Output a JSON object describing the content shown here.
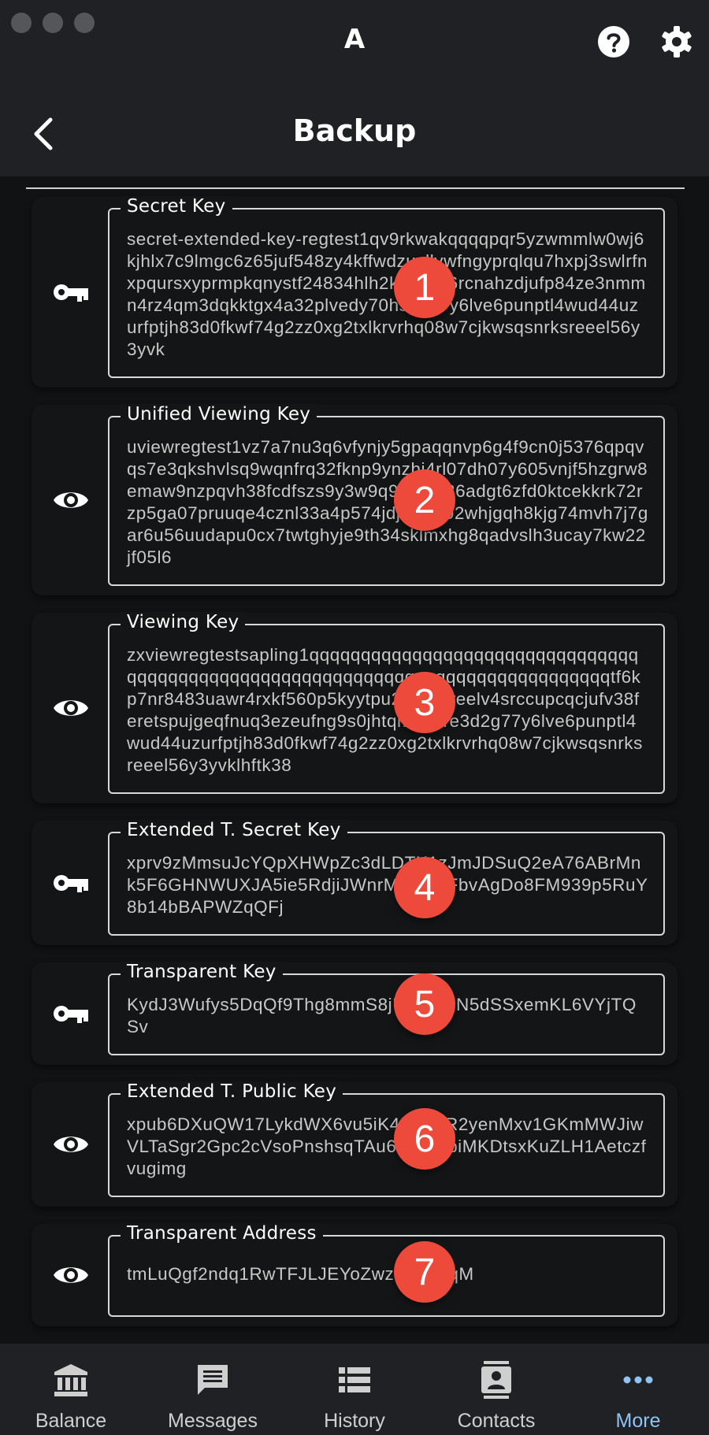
{
  "window": {
    "app_letter": "A"
  },
  "header": {
    "title": "Backup"
  },
  "keys": [
    {
      "badge": "1",
      "icon": "key-icon",
      "label": "Secret Key",
      "value": "secret-extended-key-regtest1qv9rkwakqqqqpqr5yzwmmlw0wj6kjhlx7c9lmgc6z65juf548zy4kffwdzuvllvwfngyprqlqu7hxpj3swlrfnxpqursxyprmpkqnystf24834hlh2kqqy8c6rcnahzdjufp84ze3nmmn4rz4qm3dqkktgx4a32plvedy70hspg77y6lve6punptl4wud44uzurfptjh83d0fkwf74g2zz0xg2txlkrvrhq08w7cjkwsqsnrksreeel56y3yvk"
    },
    {
      "badge": "2",
      "icon": "eye-icon",
      "label": "Unified Viewing Key",
      "value": "uviewregtest1vz7a7nu3q6vfynjy5gpaqqnvp6g4f9cn0j5376qpqvqs7e3qkshvlsq9wqnfrq32fknp9ynzhj4rl07dh07y605vnjf5hzgrw8emaw9nzpqvh38fcdfszs9y3w9q9rplm936adgt6zfd0ktcekkrk72rzp5ga07pruuqe4cznl33a4p574jdjrqahr02whjgqh8kjg74mvh7j7gar6u56uudapu0cx7twtghyje9th34sklmxhg8qadvslh3ucay7kw22jf05l6"
    },
    {
      "badge": "3",
      "icon": "eye-icon",
      "label": "Viewing Key",
      "value": "zxviewregtestsapling1qqqqqqqqqqqqqqqqqqqqqqqqqqqqqqqqqqqqqqqqqqqqqqqqqqqqqqqqqqqqqqqqqqqqqqqqqqqqqqqtf6kp7nr8483uawr4rxkf560p5kyytpu26h6pweelv4srccupcqcjufv38feretspujgeqfnuq3ezeufng9s0jhtqm5u3re3d2g77y6lve6punptl4wud44uzurfptjh83d0fkwf74g2zz0xg2txlkrvrhq08w7cjkwsqsnrksreeel56y3yvklhftk38"
    },
    {
      "badge": "4",
      "icon": "key-icon",
      "label": "Extended T. Secret Key",
      "value": "xprv9zMmsuJcYQpXHWpZc3dLDTK1zJmJDSuQ2eA76ABrMnk5F6GHNWUXJA5ie5RdjiJWnrMfZUrSFbvAgDo8FM939p5RuY8b14bBAPWZqQFj"
    },
    {
      "badge": "5",
      "icon": "key-icon",
      "label": "Transparent Key",
      "value": "KydJ3Wufys5DqQf9Thg8mmS8jUi5bM7N5dSSxemKL6VYjTQSv"
    },
    {
      "badge": "6",
      "icon": "eye-icon",
      "label": "Extended T. Public Key",
      "value": "xpub6DXuQW17LykdWX6vu5iK4Ns5ER2yenMxv1GKmMWJiwVLTaSgr2Gpc2cVsoPnshsqTAu63bWCbiMKDtsxKuZLH1Aetczfvugimg"
    },
    {
      "badge": "7",
      "icon": "eye-icon",
      "label": "Transparent Address",
      "value": "tmLuQgf2ndq1RwTFJLJEYoZwzsaqAAqM"
    }
  ],
  "nav": [
    {
      "label": "Balance",
      "icon": "bank-icon",
      "active": false
    },
    {
      "label": "Messages",
      "icon": "message-icon",
      "active": false
    },
    {
      "label": "History",
      "icon": "history-icon",
      "active": false
    },
    {
      "label": "Contacts",
      "icon": "contacts-icon",
      "active": false
    },
    {
      "label": "More",
      "icon": "more-icon",
      "active": true
    }
  ],
  "colors": {
    "accent": "#8ec4f4",
    "badge": "#ee4a3b",
    "background": "#111213",
    "bar": "#1f2124"
  }
}
